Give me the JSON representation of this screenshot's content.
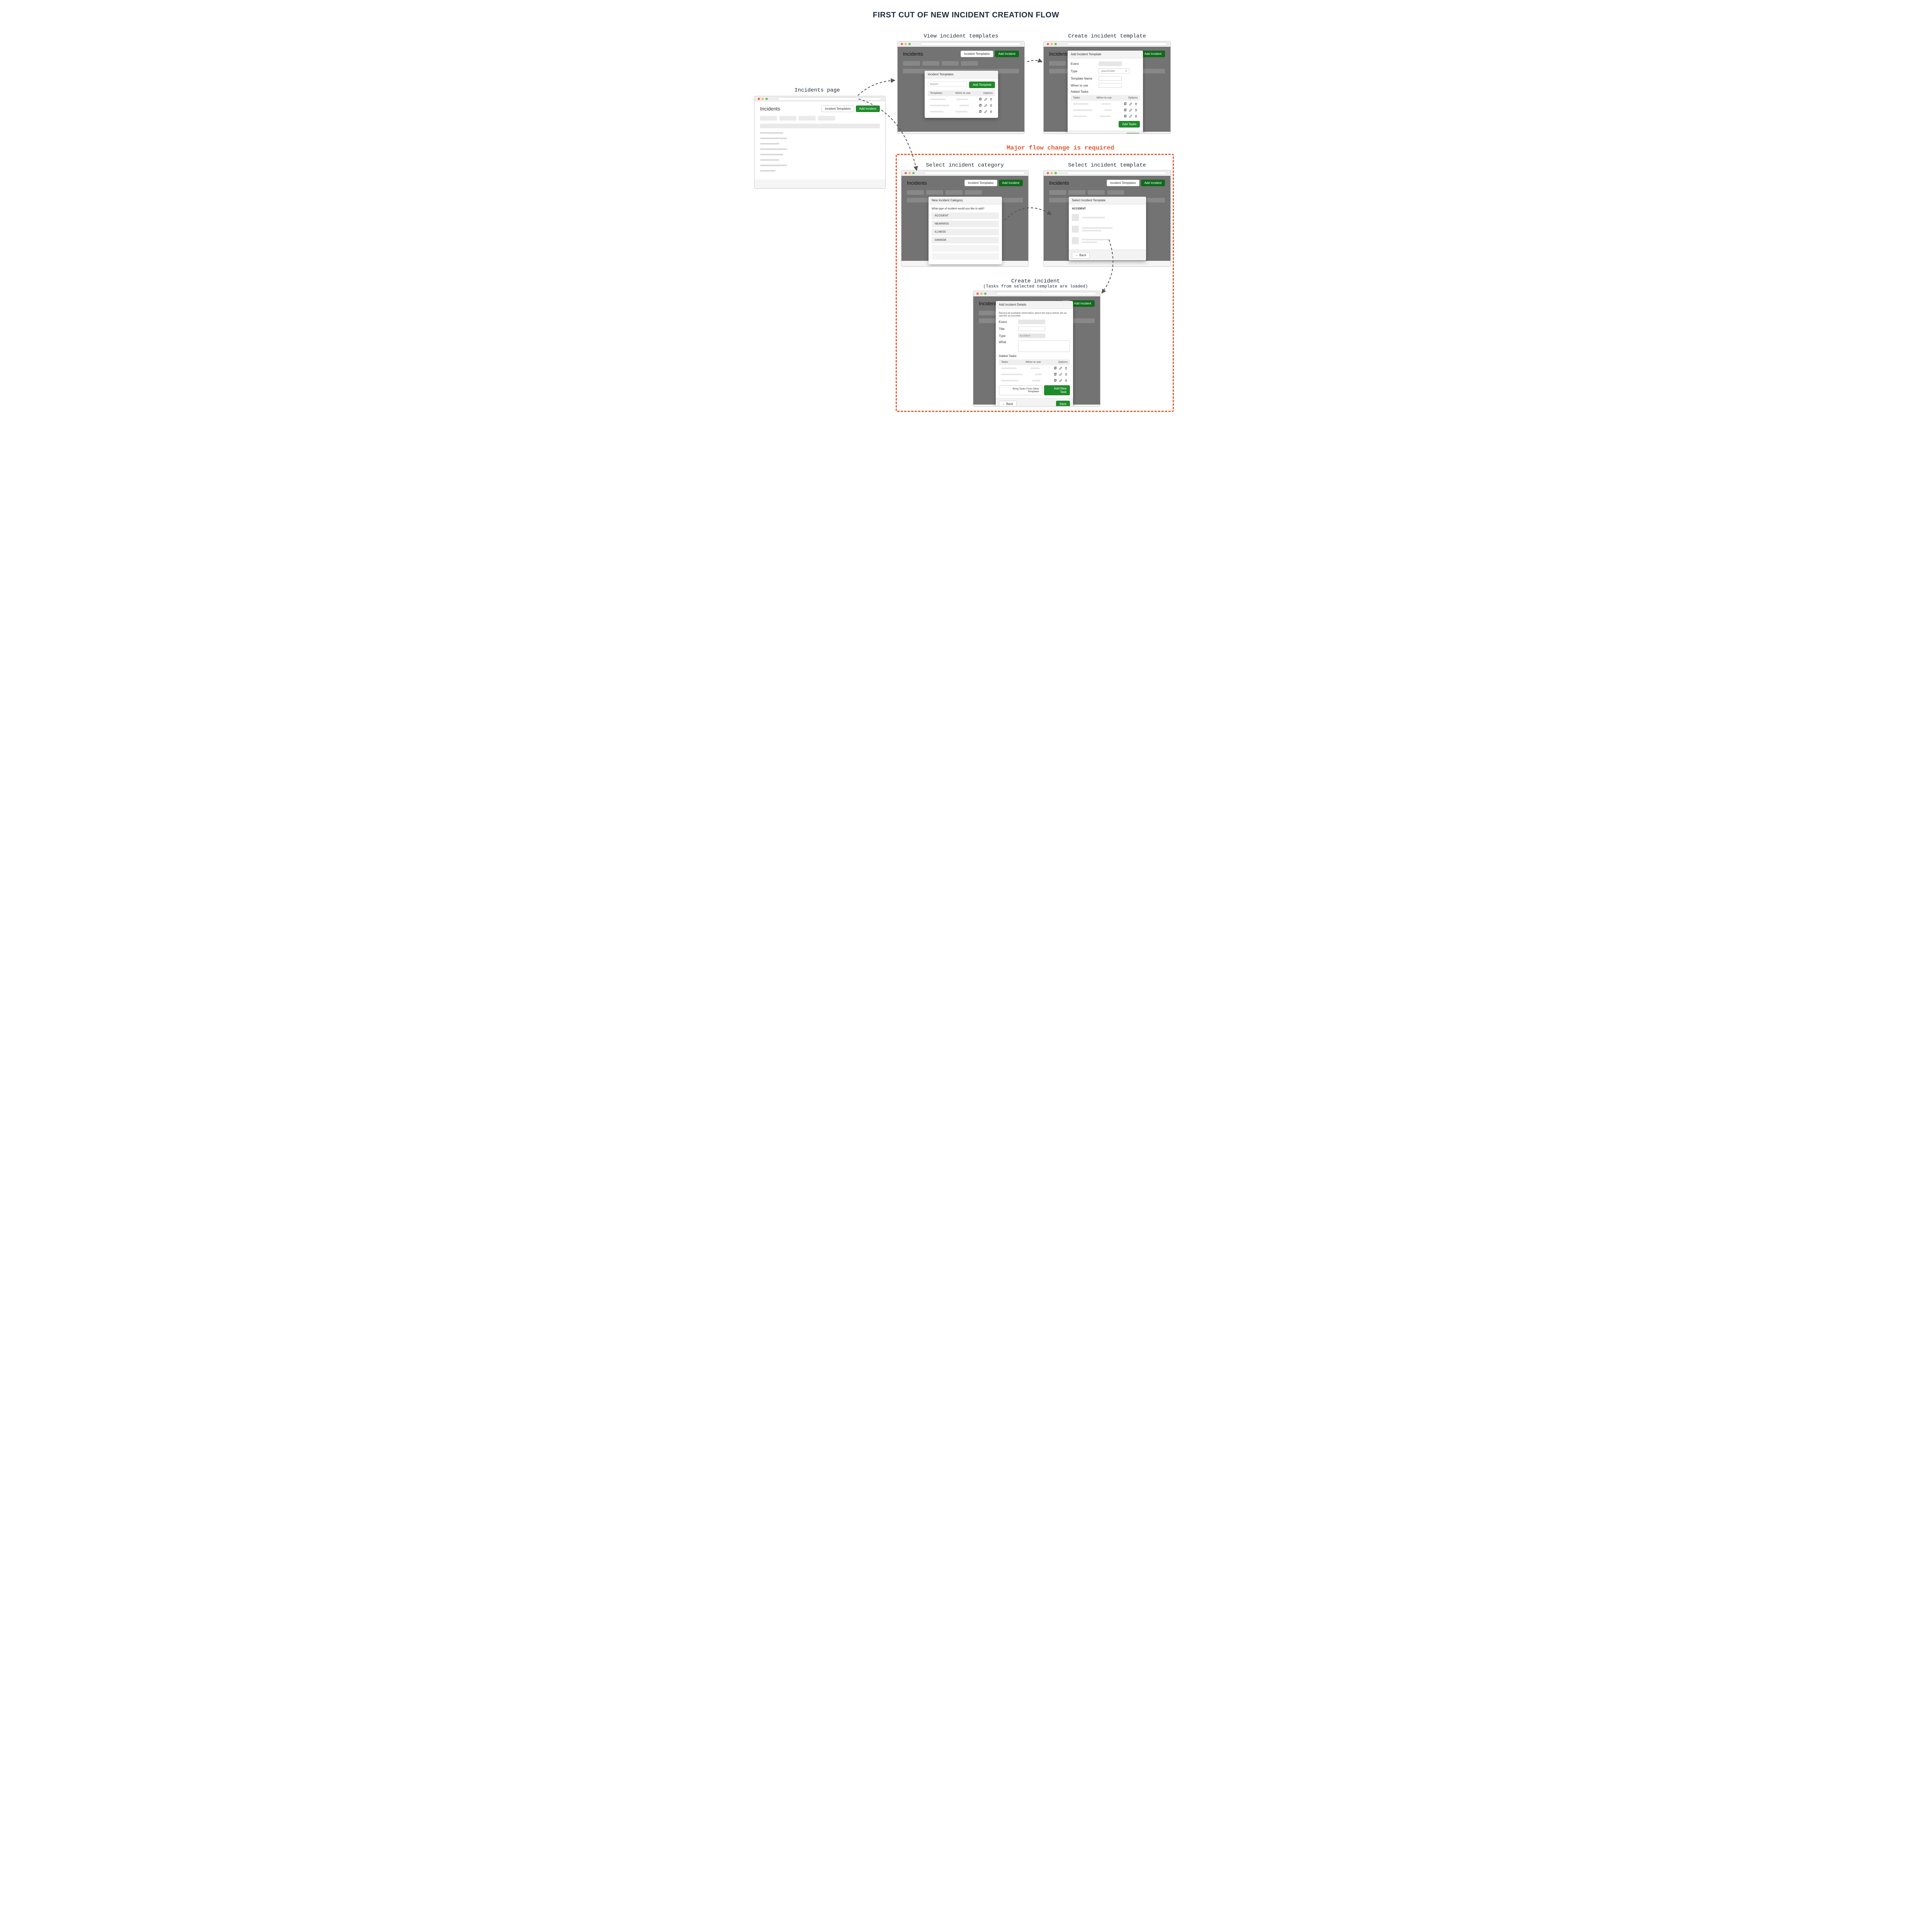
{
  "title": "FIRST CUT OF NEW INCIDENT CREATION FLOW",
  "callout": "Major flow change is required",
  "captions": {
    "incidents_page": "Incidents page",
    "view_templates": "View incident templates",
    "create_template": "Create incident template",
    "select_category": "Select incident category",
    "select_template": "Select incident template",
    "create_incident": "Create incident",
    "create_incident_sub": "(Tasks from selected template are loaded)"
  },
  "shared": {
    "page_title": "Incidents",
    "btn_incident_templates": "Incident Templates",
    "btn_add_incident": "Add Incident",
    "thead_tasks": "Tasks",
    "thead_when": "When to use",
    "thead_options": "Options",
    "btn_back": "← Back",
    "btn_save": "Save",
    "label_added_tasks": "Added Tasks"
  },
  "view_templates_modal": {
    "title": "Incident Templates",
    "search_placeholder": "Search",
    "btn_add_template": "Add Template",
    "thead_templates": "Templates"
  },
  "create_template_modal": {
    "title": "Add Incident Template",
    "lbl_event": "Event",
    "lbl_type": "Type",
    "type_placeholder": "placeholder",
    "lbl_template_name": "Template Name",
    "lbl_when_to_use": "When to use",
    "btn_add_tasks": "Add Tasks"
  },
  "select_category_modal": {
    "title": "New Incident Category",
    "prompt": "What type of incident would you like to add?",
    "options": [
      "ACCIDENT",
      "NEARMISS",
      "ILLNESS",
      "DAMAGE"
    ]
  },
  "select_template_modal": {
    "title": "Select Incident Template",
    "category": "ACCIDENT"
  },
  "create_incident_modal": {
    "title": "Add Incident Details",
    "intro": "Record all available information about the injury below. Be as specific as possible.",
    "lbl_event": "Event",
    "lbl_title": "Title",
    "lbl_type": "Type",
    "type_value": "Accident",
    "lbl_what": "What",
    "btn_bring_tasks": "Bring Tasks From Other Templates",
    "btn_add_new_task": "Add New Task"
  }
}
